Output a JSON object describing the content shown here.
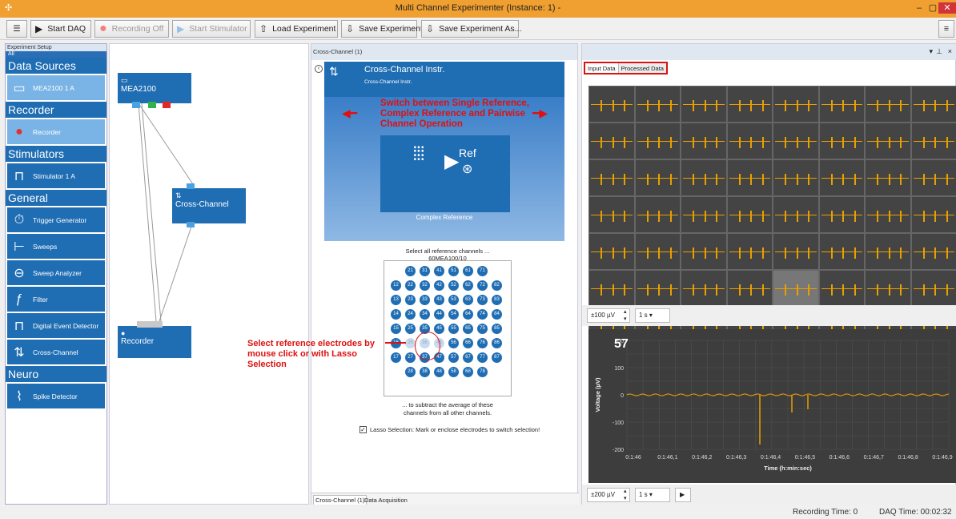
{
  "window": {
    "title": "Multi Channel Experimenter (Instance: 1) -"
  },
  "toolbar": {
    "start_daq": "Start DAQ",
    "recording": "Recording Off",
    "stimulator": "Start Stimulator",
    "load": "Load Experiment",
    "save": "Save Experiment",
    "save_as": "Save Experiment As..."
  },
  "setup": {
    "header": "Experiment Setup",
    "all": "All",
    "cat_data_sources": "Data Sources",
    "item_mea": "MEA2100   1   A",
    "cat_recorder": "Recorder",
    "item_recorder": "Recorder",
    "cat_stimulators": "Stimulators",
    "item_stimulator": "Stimulator   1   A",
    "cat_general": "General",
    "item_trigger": "Trigger Generator",
    "item_sweeps": "Sweeps",
    "item_sweep_an": "Sweep Analyzer",
    "item_filter": "Filter",
    "item_digital": "Digital Event Detector",
    "item_crosschannel": "Cross-Channel",
    "cat_neuro": "Neuro",
    "item_spike": "Spike Detector"
  },
  "canvas": {
    "node_mea": "MEA2100",
    "node_cc": "Cross-Channel",
    "node_rec": "Recorder"
  },
  "cc_panel": {
    "title": "Cross-Channel (1)",
    "head_title": "Cross-Channel Instr.",
    "head_sub": "Cross-Channel Instr.",
    "annot_top": "Switch between Single Reference, Complex Reference and Pairwise Channel Operation",
    "ref_label": "Ref",
    "complex_ref": "Complex Reference",
    "select_all": "Select all reference channels ...",
    "layout": "60MEA100/10",
    "subtract1": "... to subtract the average of these",
    "subtract2": "channels from all other channels.",
    "annot_left": "Select reference electrodes by mouse click or with Lasso Selection",
    "lasso": "Lasso Selection: Mark or enclose electrodes to switch selection!",
    "tab1": "Cross-Channel (1)",
    "tab2": "Data Acquisition"
  },
  "electrodes": [
    [
      "",
      "21",
      "31",
      "41",
      "51",
      "61",
      "71",
      ""
    ],
    [
      "12",
      "22",
      "32",
      "42",
      "52",
      "62",
      "72",
      "82"
    ],
    [
      "13",
      "23",
      "33",
      "43",
      "53",
      "63",
      "73",
      "83"
    ],
    [
      "14",
      "24",
      "34",
      "44",
      "54",
      "64",
      "74",
      "84"
    ],
    [
      "15",
      "25",
      "35",
      "45",
      "55",
      "65",
      "75",
      "85"
    ],
    [
      "16",
      "26",
      "36",
      "46",
      "56",
      "66",
      "76",
      "86"
    ],
    [
      "17",
      "27",
      "37",
      "47",
      "57",
      "67",
      "77",
      "87"
    ],
    [
      "",
      "28",
      "38",
      "48",
      "58",
      "68",
      "78",
      ""
    ]
  ],
  "right": {
    "tab_input": "Input Data",
    "tab_processed": "Processed Data",
    "range_top": "±100 µV",
    "time_top": "1 s",
    "channel_big": "57",
    "ylabel": "Voltage (µV)",
    "xlabel": "Time (h:min:sec)",
    "yticks": [
      "200",
      "100",
      "0",
      "-100",
      "-200"
    ],
    "xticks": [
      "0:1:46",
      "0:1:46,1",
      "0:1:46,2",
      "0:1:46,3",
      "0:1:46,4",
      "0:1:46,5",
      "0:1:46,6",
      "0:1:46,7",
      "0:1:46,8",
      "0:1:46,9"
    ],
    "range_bot": "±200 µV",
    "time_bot": "1 s"
  },
  "status": {
    "recording_time": "Recording Time:  0",
    "daq_time": "DAQ Time:  00:02:32"
  }
}
